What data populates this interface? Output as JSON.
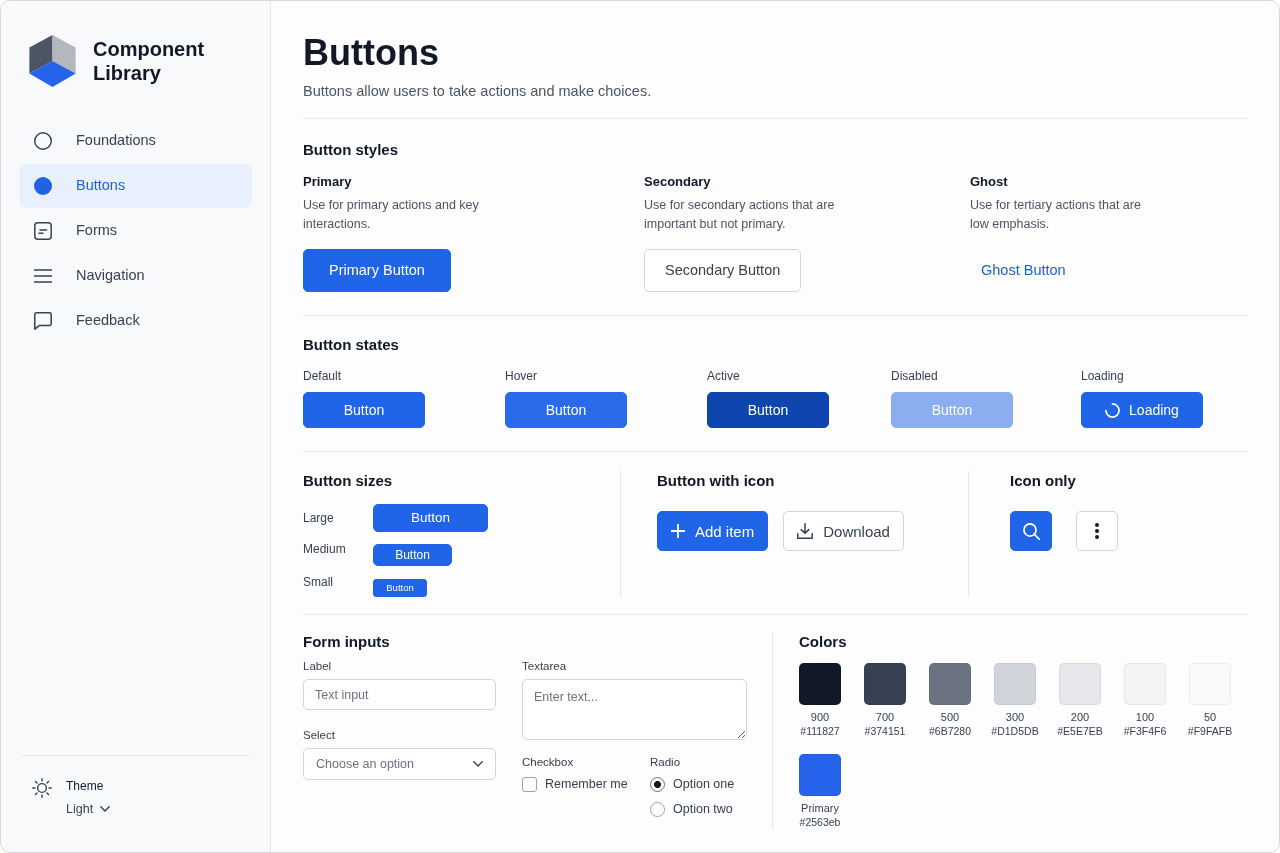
{
  "sidebar": {
    "brand": "Component Library",
    "items": [
      {
        "label": "Foundations",
        "kind": "circle",
        "selected": false
      },
      {
        "label": "Buttons",
        "kind": "circle",
        "selected": true
      },
      {
        "label": "Forms",
        "kind": "form",
        "selected": false
      },
      {
        "label": "Navigation",
        "kind": "menu",
        "selected": false
      },
      {
        "label": "Feedback",
        "kind": "chat",
        "selected": false
      }
    ],
    "theme": {
      "label": "Theme",
      "value": "Light"
    }
  },
  "header": {
    "title": "Buttons",
    "subtitle": "Buttons allow users to take actions and make choices."
  },
  "button_styles": {
    "heading": "Button styles",
    "variants": [
      {
        "kind": "primary",
        "title": "Primary",
        "description": "Use for primary actions and key interactions.",
        "button": "Primary Button"
      },
      {
        "kind": "secondary",
        "title": "Secondary",
        "description": "Use for secondary actions that are important but not primary.",
        "button": "Secondary Button"
      },
      {
        "kind": "ghost",
        "title": "Ghost",
        "description": "Use for tertiary actions that are low emphasis.",
        "button": "Ghost Button"
      }
    ]
  },
  "button_states": {
    "heading": "Button states",
    "states": [
      {
        "kind": "default",
        "label": "Default",
        "button": "Button"
      },
      {
        "kind": "hover",
        "label": "Hover",
        "button": "Button"
      },
      {
        "kind": "active",
        "label": "Active",
        "button": "Button"
      },
      {
        "kind": "disabled",
        "label": "Disabled",
        "button": "Button"
      },
      {
        "kind": "loading",
        "label": "Loading",
        "button": "Loading"
      }
    ]
  },
  "button_sizes": {
    "heading": "Button sizes",
    "sizes": [
      {
        "kind": "large",
        "label": "Large",
        "button": "Button"
      },
      {
        "kind": "medium",
        "label": "Medium",
        "button": "Button"
      },
      {
        "kind": "small",
        "label": "Small",
        "button": "Button"
      }
    ]
  },
  "button_with_icon": {
    "heading": "Button with icon",
    "buttons": [
      {
        "kind": "add",
        "label": "Add item"
      },
      {
        "kind": "download",
        "label": "Download"
      }
    ]
  },
  "icon_only": {
    "heading": "Icon only",
    "buttons": [
      {
        "kind": "search"
      },
      {
        "kind": "more"
      }
    ]
  },
  "form_inputs": {
    "heading": "Form inputs",
    "text_input": {
      "label": "Label",
      "placeholder": "Text input"
    },
    "select": {
      "label": "Select",
      "placeholder": "Choose an option"
    },
    "textarea": {
      "label": "Textarea",
      "placeholder": "Enter text..."
    },
    "checkbox": {
      "label": "Checkbox",
      "option": "Remember me",
      "checked": false
    },
    "radio": {
      "label": "Radio",
      "options": [
        {
          "label": "Option one",
          "selected": true
        },
        {
          "label": "Option two",
          "selected": false
        }
      ]
    }
  },
  "colors": {
    "heading": "Colors",
    "swatches": [
      {
        "name": "900",
        "hex": "#111827",
        "color": "#111827"
      },
      {
        "name": "700",
        "hex": "#374151",
        "color": "#374151"
      },
      {
        "name": "500",
        "hex": "#6B7280",
        "color": "#6b7280"
      },
      {
        "name": "300",
        "hex": "#D1D5DB",
        "color": "#d1d5db"
      },
      {
        "name": "200",
        "hex": "#E5E7EB",
        "color": "#e5e7eb"
      },
      {
        "name": "100",
        "hex": "#F3F4F6",
        "color": "#f3f4f6"
      },
      {
        "name": "50",
        "hex": "#F9FAFB",
        "color": "#f9fafb"
      },
      {
        "name": "Primary",
        "hex": "#2563eb",
        "color": "#2563eb"
      }
    ]
  }
}
